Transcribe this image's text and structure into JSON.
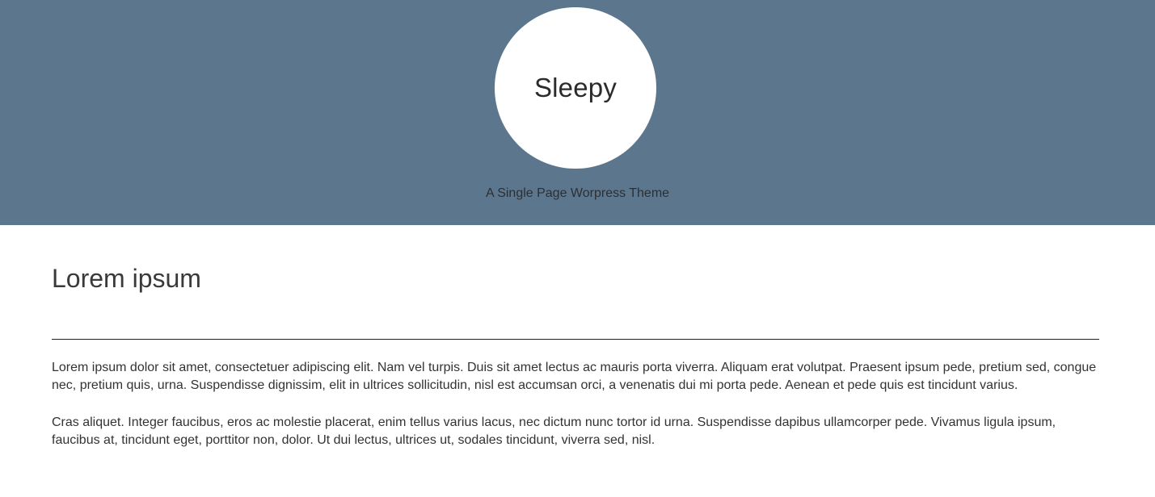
{
  "header": {
    "site_title": "Sleepy",
    "tagline": "A Single Page Worpress Theme",
    "background_color": "#5c778d"
  },
  "main": {
    "section_title": "Lorem ipsum",
    "paragraphs": [
      "Lorem ipsum dolor sit amet, consectetuer adipiscing elit. Nam vel turpis. Duis sit amet lectus ac mauris porta viverra. Aliquam erat volutpat. Praesent ipsum pede, pretium sed, congue nec, pretium quis, urna. Suspendisse dignissim, elit in ultrices sollicitudin, nisl est accumsan orci, a venenatis dui mi porta pede. Aenean et pede quis est tincidunt varius.",
      "Cras aliquet. Integer faucibus, eros ac molestie placerat, enim tellus varius lacus, nec dictum nunc tortor id urna. Suspendisse dapibus ullamcorper pede. Vivamus ligula ipsum, faucibus at, tincidunt eget, porttitor non, dolor. Ut dui lectus, ultrices ut, sodales tincidunt, viverra sed, nisl."
    ]
  }
}
